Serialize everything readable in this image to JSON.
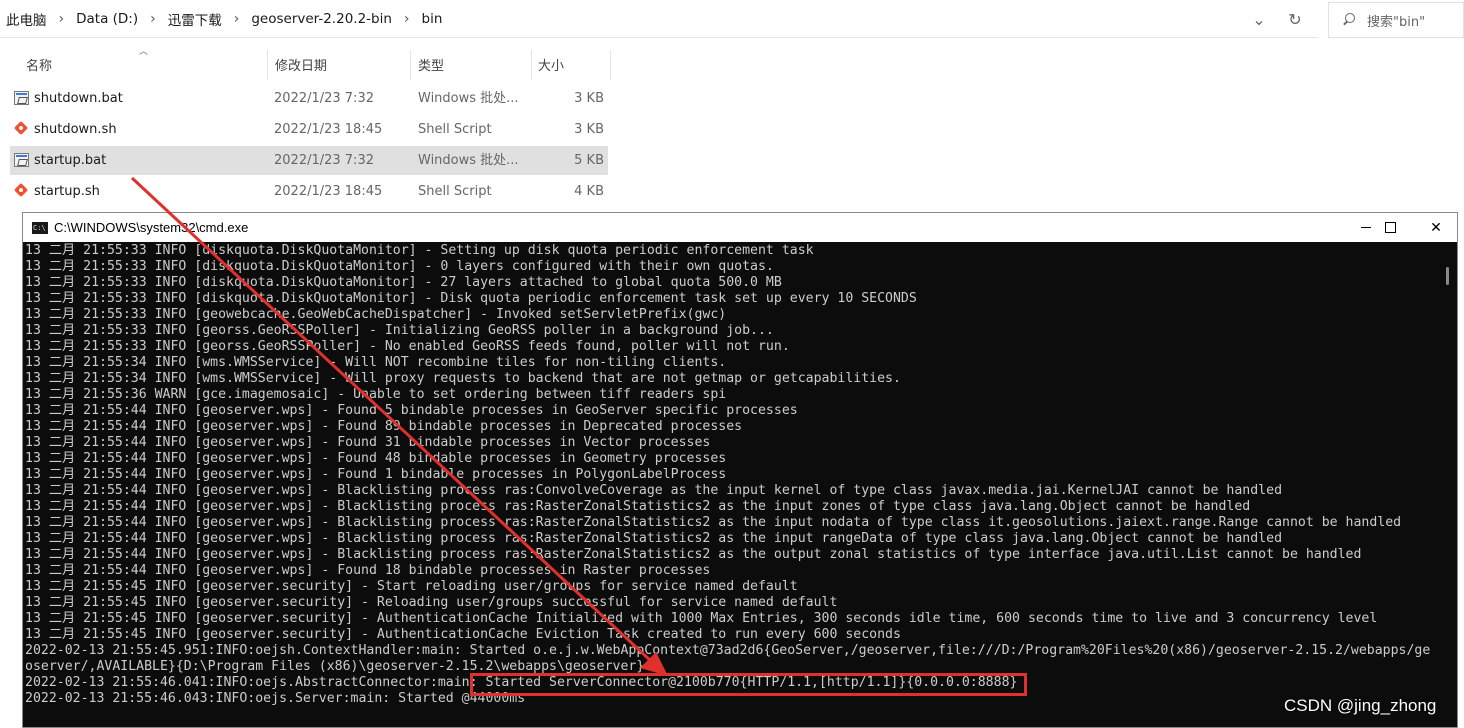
{
  "explorer": {
    "breadcrumbs": [
      "此电脑",
      "Data (D:)",
      "迅雷下载",
      "geoserver-2.20.2-bin",
      "bin"
    ],
    "search_placeholder": "搜索\"bin\"",
    "columns": {
      "name": "名称",
      "date": "修改日期",
      "type": "类型",
      "size": "大小"
    },
    "files": [
      {
        "name": "shutdown.bat",
        "date": "2022/1/23 7:32",
        "type": "Windows 批处...",
        "size": "3 KB",
        "icon": "bat-file-icon",
        "selected": false
      },
      {
        "name": "shutdown.sh",
        "date": "2022/1/23 18:45",
        "type": "Shell Script",
        "size": "3 KB",
        "icon": "sh-file-icon",
        "selected": false
      },
      {
        "name": "startup.bat",
        "date": "2022/1/23 7:32",
        "type": "Windows 批处...",
        "size": "5 KB",
        "icon": "bat-file-icon",
        "selected": true
      },
      {
        "name": "startup.sh",
        "date": "2022/1/23 18:45",
        "type": "Shell Script",
        "size": "4 KB",
        "icon": "sh-file-icon",
        "selected": false
      }
    ]
  },
  "cmd": {
    "title": "C:\\WINDOWS\\system32\\cmd.exe",
    "lines": [
      "13 二月 21:55:33 INFO [diskquota.DiskQuotaMonitor] - Setting up disk quota periodic enforcement task",
      "13 二月 21:55:33 INFO [diskquota.DiskQuotaMonitor] - 0 layers configured with their own quotas.",
      "13 二月 21:55:33 INFO [diskquota.DiskQuotaMonitor] - 27 layers attached to global quota 500.0 MB",
      "13 二月 21:55:33 INFO [diskquota.DiskQuotaMonitor] - Disk quota periodic enforcement task set up every 10 SECONDS",
      "13 二月 21:55:33 INFO [geowebcache.GeoWebCacheDispatcher] - Invoked setServletPrefix(gwc)",
      "13 二月 21:55:33 INFO [georss.GeoRSSPoller] - Initializing GeoRSS poller in a background job...",
      "13 二月 21:55:33 INFO [georss.GeoRSSPoller] - No enabled GeoRSS feeds found, poller will not run.",
      "13 二月 21:55:34 INFO [wms.WMSService] - Will NOT recombine tiles for non-tiling clients.",
      "13 二月 21:55:34 INFO [wms.WMSService] - Will proxy requests to backend that are not getmap or getcapabilities.",
      "13 二月 21:55:36 WARN [gce.imagemosaic] - Unable to set ordering between tiff readers spi",
      "13 二月 21:55:44 INFO [geoserver.wps] - Found 5 bindable processes in GeoServer specific processes",
      "13 二月 21:55:44 INFO [geoserver.wps] - Found 89 bindable processes in Deprecated processes",
      "13 二月 21:55:44 INFO [geoserver.wps] - Found 31 bindable processes in Vector processes",
      "13 二月 21:55:44 INFO [geoserver.wps] - Found 48 bindable processes in Geometry processes",
      "13 二月 21:55:44 INFO [geoserver.wps] - Found 1 bindable processes in PolygonLabelProcess",
      "13 二月 21:55:44 INFO [geoserver.wps] - Blacklisting process ras:ConvolveCoverage as the input kernel of type class javax.media.jai.KernelJAI cannot be handled",
      "13 二月 21:55:44 INFO [geoserver.wps] - Blacklisting process ras:RasterZonalStatistics2 as the input zones of type class java.lang.Object cannot be handled",
      "13 二月 21:55:44 INFO [geoserver.wps] - Blacklisting process ras:RasterZonalStatistics2 as the input nodata of type class it.geosolutions.jaiext.range.Range cannot be handled",
      "13 二月 21:55:44 INFO [geoserver.wps] - Blacklisting process ras:RasterZonalStatistics2 as the input rangeData of type class java.lang.Object cannot be handled",
      "13 二月 21:55:44 INFO [geoserver.wps] - Blacklisting process ras:RasterZonalStatistics2 as the output zonal statistics of type interface java.util.List cannot be handled",
      "13 二月 21:55:44 INFO [geoserver.wps] - Found 18 bindable processes in Raster processes",
      "13 二月 21:55:45 INFO [geoserver.security] - Start reloading user/groups for service named default",
      "13 二月 21:55:45 INFO [geoserver.security] - Reloading user/groups successful for service named default",
      "13 二月 21:55:45 INFO [geoserver.security] - AuthenticationCache Initialized with 1000 Max Entries, 300 seconds idle time, 600 seconds time to live and 3 concurrency level",
      "13 二月 21:55:45 INFO [geoserver.security] - AuthenticationCache Eviction Task created to run every 600 seconds",
      "2022-02-13 21:55:45.951:INFO:oejsh.ContextHandler:main: Started o.e.j.w.WebAppContext@73ad2d6{GeoServer,/geoserver,file:///D:/Program%20Files%20(x86)/geoserver-2.15.2/webapps/ge",
      "oserver/,AVAILABLE}{D:\\Program Files (x86)\\geoserver-2.15.2\\webapps\\geoserver}",
      "2022-02-13 21:55:46.041:INFO:oejs.AbstractConnector:main: Started ServerConnector@2100b770{HTTP/1.1,[http/1.1]}{0.0.0.0:8888}",
      "2022-02-13 21:55:46.043:INFO:oejs.Server:main: Started @44000ms"
    ]
  },
  "watermark": "CSDN @jing_zhong",
  "colors": {
    "annotation": "#e0302e",
    "console_bg": "#0c0c0c",
    "console_text": "#cccccc",
    "selected_row": "#e0e0e0"
  }
}
